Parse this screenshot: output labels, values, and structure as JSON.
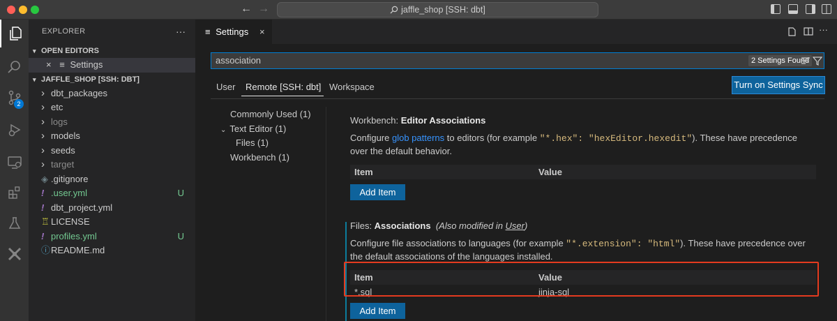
{
  "titlebar": {
    "title": "jaffle_shop [SSH: dbt]",
    "back": "←",
    "forward": "→"
  },
  "activity": {
    "scm_badge": "2"
  },
  "sidebar": {
    "header": "EXPLORER",
    "more": "···",
    "open_editors": {
      "title": "OPEN EDITORS",
      "items": [
        {
          "close": "×",
          "label": "Settings"
        }
      ]
    },
    "workspace": {
      "title": "JAFFLE_SHOP [SSH: DBT]",
      "items": [
        {
          "label": "dbt_packages",
          "type": "folder",
          "color": "#cccccc"
        },
        {
          "label": "etc",
          "type": "folder",
          "color": "#cccccc"
        },
        {
          "label": "logs",
          "type": "folder",
          "color": "#8c8c8c"
        },
        {
          "label": "models",
          "type": "folder",
          "color": "#cccccc"
        },
        {
          "label": "seeds",
          "type": "folder",
          "color": "#cccccc"
        },
        {
          "label": "target",
          "type": "folder",
          "color": "#8c8c8c"
        },
        {
          "label": ".gitignore",
          "type": "git",
          "color": "#cccccc"
        },
        {
          "label": ".user.yml",
          "type": "yaml",
          "color": "#73c991",
          "status": "U"
        },
        {
          "label": "dbt_project.yml",
          "type": "yaml",
          "color": "#cccccc"
        },
        {
          "label": "LICENSE",
          "type": "license",
          "color": "#cccccc"
        },
        {
          "label": "profiles.yml",
          "type": "yaml",
          "color": "#73c991",
          "status": "U"
        },
        {
          "label": "README.md",
          "type": "info",
          "color": "#cccccc"
        }
      ]
    }
  },
  "editor": {
    "tab": {
      "label": "Settings",
      "close": "×"
    },
    "search": {
      "value": "association",
      "found": "2 Settings Found"
    },
    "scopes": [
      "User",
      "Remote [SSH: dbt]",
      "Workspace"
    ],
    "sync_button": "Turn on Settings Sync",
    "toc": [
      "Commonly Used (1)",
      "Text Editor (1)",
      "Files (1)",
      "Workbench (1)"
    ],
    "settings": [
      {
        "category": "Workbench: ",
        "name": "Editor Associations",
        "desc_pre": "Configure ",
        "desc_link": "glob patterns",
        "desc_mid": " to editors (for example ",
        "desc_code": "\"*.hex\": \"hexEditor.hexedit\"",
        "desc_post": "). These have precedence over the default behavior.",
        "col_item": "Item",
        "col_value": "Value",
        "add": "Add Item"
      },
      {
        "category": "Files: ",
        "name": "Associations",
        "modified_pre": "(Also modified in ",
        "modified_link": "User",
        "modified_post": ")",
        "desc_pre": "Configure file associations to languages (for example ",
        "desc_code": "\"*.extension\": \"html\"",
        "desc_post": "). These have precedence over the default associations of the languages installed.",
        "col_item": "Item",
        "col_value": "Value",
        "row_item": "*.sql",
        "row_value": "jinja-sql",
        "add": "Add Item"
      }
    ]
  }
}
